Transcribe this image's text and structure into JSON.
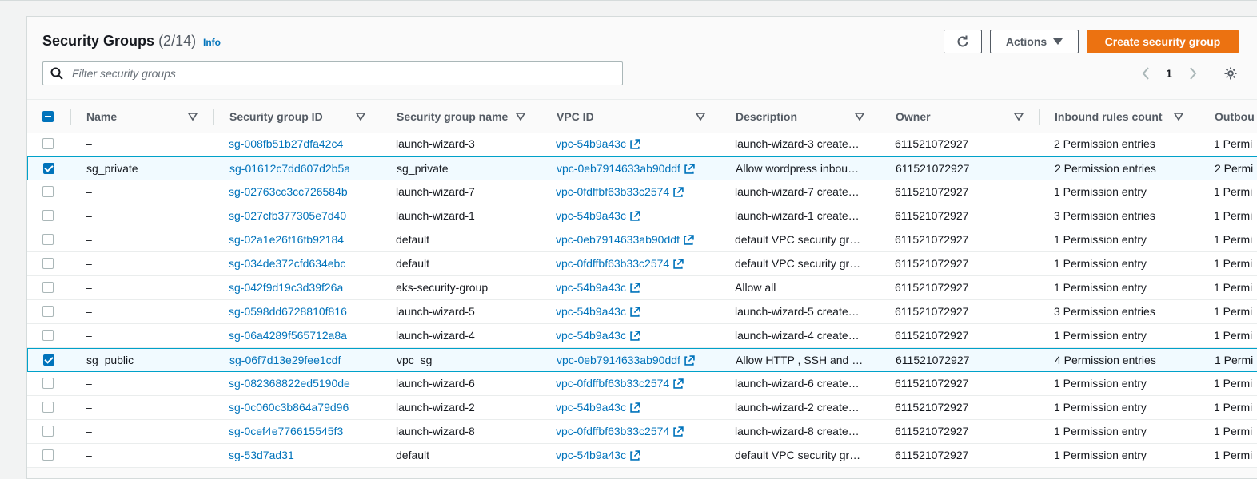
{
  "header": {
    "title": "Security Groups",
    "count": "(2/14)",
    "info_label": "Info"
  },
  "toolbar": {
    "refresh_icon": "refresh-icon",
    "actions_label": "Actions",
    "create_label": "Create security group"
  },
  "search": {
    "placeholder": "Filter security groups",
    "value": ""
  },
  "pagination": {
    "current_page": "1"
  },
  "colors": {
    "accent": "#0073bb",
    "primary_button": "#ec7211",
    "selected_row": "#f1faff",
    "selected_border": "#00a1c9"
  },
  "table": {
    "columns": [
      "Name",
      "Security group ID",
      "Security group name",
      "VPC ID",
      "Description",
      "Owner",
      "Inbound rules count",
      "Outbou"
    ],
    "rows": [
      {
        "selected": false,
        "name": "–",
        "sg_id": "sg-008fb51b27dfa42c4",
        "sg_name": "launch-wizard-3",
        "vpc": "vpc-54b9a43c",
        "desc": "launch-wizard-3 create…",
        "owner": "611521072927",
        "inbound": "2 Permission entries",
        "outbound": "1 Permi"
      },
      {
        "selected": true,
        "name": "sg_private",
        "sg_id": "sg-01612c7dd607d2b5a",
        "sg_name": "sg_private",
        "vpc": "vpc-0eb7914633ab90ddf",
        "desc": "Allow wordpress inbou…",
        "owner": "611521072927",
        "inbound": "2 Permission entries",
        "outbound": "2 Permi"
      },
      {
        "selected": false,
        "name": "–",
        "sg_id": "sg-02763cc3cc726584b",
        "sg_name": "launch-wizard-7",
        "vpc": "vpc-0fdffbf63b33c2574",
        "desc": "launch-wizard-7 create…",
        "owner": "611521072927",
        "inbound": "1 Permission entry",
        "outbound": "1 Permi"
      },
      {
        "selected": false,
        "name": "–",
        "sg_id": "sg-027cfb377305e7d40",
        "sg_name": "launch-wizard-1",
        "vpc": "vpc-54b9a43c",
        "desc": "launch-wizard-1 create…",
        "owner": "611521072927",
        "inbound": "3 Permission entries",
        "outbound": "1 Permi"
      },
      {
        "selected": false,
        "name": "–",
        "sg_id": "sg-02a1e26f16fb92184",
        "sg_name": "default",
        "vpc": "vpc-0eb7914633ab90ddf",
        "desc": "default VPC security gr…",
        "owner": "611521072927",
        "inbound": "1 Permission entry",
        "outbound": "1 Permi"
      },
      {
        "selected": false,
        "name": "–",
        "sg_id": "sg-034de372cfd634ebc",
        "sg_name": "default",
        "vpc": "vpc-0fdffbf63b33c2574",
        "desc": "default VPC security gr…",
        "owner": "611521072927",
        "inbound": "1 Permission entry",
        "outbound": "1 Permi"
      },
      {
        "selected": false,
        "name": "–",
        "sg_id": "sg-042f9d19c3d39f26a",
        "sg_name": "eks-security-group",
        "vpc": "vpc-54b9a43c",
        "desc": "Allow all",
        "owner": "611521072927",
        "inbound": "1 Permission entry",
        "outbound": "1 Permi"
      },
      {
        "selected": false,
        "name": "–",
        "sg_id": "sg-0598dd6728810f816",
        "sg_name": "launch-wizard-5",
        "vpc": "vpc-54b9a43c",
        "desc": "launch-wizard-5 create…",
        "owner": "611521072927",
        "inbound": "3 Permission entries",
        "outbound": "1 Permi"
      },
      {
        "selected": false,
        "name": "–",
        "sg_id": "sg-06a4289f565712a8a",
        "sg_name": "launch-wizard-4",
        "vpc": "vpc-54b9a43c",
        "desc": "launch-wizard-4 create…",
        "owner": "611521072927",
        "inbound": "1 Permission entry",
        "outbound": "1 Permi"
      },
      {
        "selected": true,
        "name": "sg_public",
        "sg_id": "sg-06f7d13e29fee1cdf",
        "sg_name": "vpc_sg",
        "vpc": "vpc-0eb7914633ab90ddf",
        "desc": "Allow HTTP , SSH and …",
        "owner": "611521072927",
        "inbound": "4 Permission entries",
        "outbound": "1 Permi"
      },
      {
        "selected": false,
        "name": "–",
        "sg_id": "sg-082368822ed5190de",
        "sg_name": "launch-wizard-6",
        "vpc": "vpc-0fdffbf63b33c2574",
        "desc": "launch-wizard-6 create…",
        "owner": "611521072927",
        "inbound": "1 Permission entry",
        "outbound": "1 Permi"
      },
      {
        "selected": false,
        "name": "–",
        "sg_id": "sg-0c060c3b864a79d96",
        "sg_name": "launch-wizard-2",
        "vpc": "vpc-54b9a43c",
        "desc": "launch-wizard-2 create…",
        "owner": "611521072927",
        "inbound": "1 Permission entry",
        "outbound": "1 Permi"
      },
      {
        "selected": false,
        "name": "–",
        "sg_id": "sg-0cef4e776615545f3",
        "sg_name": "launch-wizard-8",
        "vpc": "vpc-0fdffbf63b33c2574",
        "desc": "launch-wizard-8 create…",
        "owner": "611521072927",
        "inbound": "1 Permission entry",
        "outbound": "1 Permi"
      },
      {
        "selected": false,
        "name": "–",
        "sg_id": "sg-53d7ad31",
        "sg_name": "default",
        "vpc": "vpc-54b9a43c",
        "desc": "default VPC security gr…",
        "owner": "611521072927",
        "inbound": "1 Permission entry",
        "outbound": "1 Permi"
      }
    ]
  }
}
